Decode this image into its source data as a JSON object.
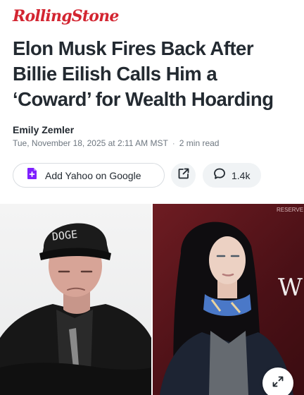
{
  "brand": {
    "logo_text": "RollingStone",
    "color": "#d32531"
  },
  "article": {
    "headline_lines": [
      "Elon Musk Fires Back After",
      "Billie Eilish Calls Him a",
      "‘Coward’ for Wealth Hoarding"
    ],
    "author": "Emily Zemler",
    "date": "Tue, November 18, 2025 at 2:11 AM MST",
    "separator": "·",
    "read_time": "2 min read"
  },
  "actions": {
    "yahoo_button": {
      "label": "Add Yahoo on Google",
      "icon": "plus-document-icon",
      "icon_color": "#7e1fff"
    },
    "share_button": {
      "icon": "share-external-icon"
    },
    "comment_button": {
      "count": "1.4k",
      "icon": "comment-bubble-icon"
    }
  },
  "photos": {
    "left": {
      "cap_text": "DOGE"
    },
    "right": {
      "backdrop_text": "WSJ",
      "backdrop_small": "RESERVE"
    },
    "expand_button": {
      "icon": "expand-arrows-icon"
    }
  }
}
